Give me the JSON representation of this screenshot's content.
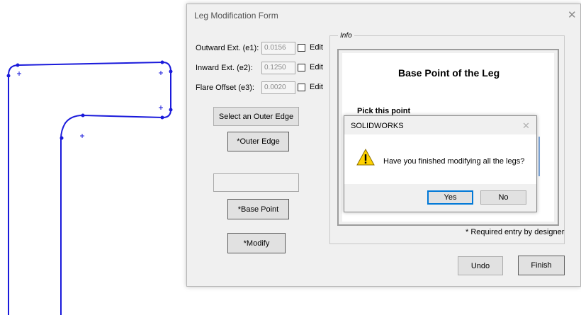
{
  "form": {
    "title": "Leg Modification Form",
    "close_glyph": "✕",
    "fields": [
      {
        "label": "Outward Ext. (e1):",
        "value": "0.0156",
        "edit_label": "Edit",
        "checked": false
      },
      {
        "label": "Inward Ext. (e2):",
        "value": "0.1250",
        "edit_label": "Edit",
        "checked": false
      },
      {
        "label": "Flare Offset (e3):",
        "value": "0.0020",
        "edit_label": "Edit",
        "checked": false
      }
    ],
    "select_outer_edge_label": "Select an Outer Edge",
    "outer_edge_label": "*Outer Edge",
    "base_point_value": "",
    "base_point_label": "*Base Point",
    "modify_label": "*Modify",
    "info": {
      "legend": "Info",
      "title": "Base Point of the Leg",
      "subtitle": "Pick this point",
      "required_note": "* Required entry by designer"
    },
    "undo_label": "Undo",
    "finish_label": "Finish"
  },
  "dialog": {
    "title": "SOLIDWORKS",
    "close_glyph": "✕",
    "icon": "warning-icon",
    "message": "Have you finished modifying all the legs?",
    "yes_label": "Yes",
    "no_label": "No"
  },
  "colors": {
    "sketch": "#1a1adb",
    "dialog_default_border": "#0078d7",
    "warning_fill": "#ffd200"
  }
}
